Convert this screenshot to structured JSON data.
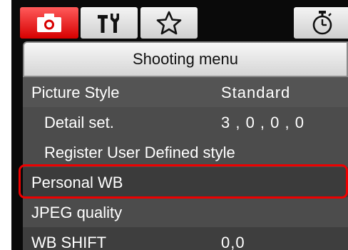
{
  "tabs": [
    {
      "icon": "camera-icon",
      "active": true
    },
    {
      "icon": "tools-icon",
      "active": false
    },
    {
      "icon": "star-icon",
      "active": false
    },
    {
      "icon": "timer-icon",
      "active": false
    }
  ],
  "menu": {
    "title": "Shooting menu",
    "items": [
      {
        "label": "Picture Style",
        "value": "Standard"
      },
      {
        "label": "Detail set.",
        "value": "3 , 0 , 0 , 0"
      },
      {
        "label": "Register User Defined style",
        "value": ""
      },
      {
        "label": "Personal WB",
        "value": "",
        "selected": true
      },
      {
        "label": "JPEG quality",
        "value": ""
      },
      {
        "label": "WB SHIFT",
        "value": "0,0"
      }
    ]
  },
  "colors": {
    "active_tab": "#e60000",
    "highlight_border": "#ee0000",
    "panel_bg": "#545454"
  }
}
